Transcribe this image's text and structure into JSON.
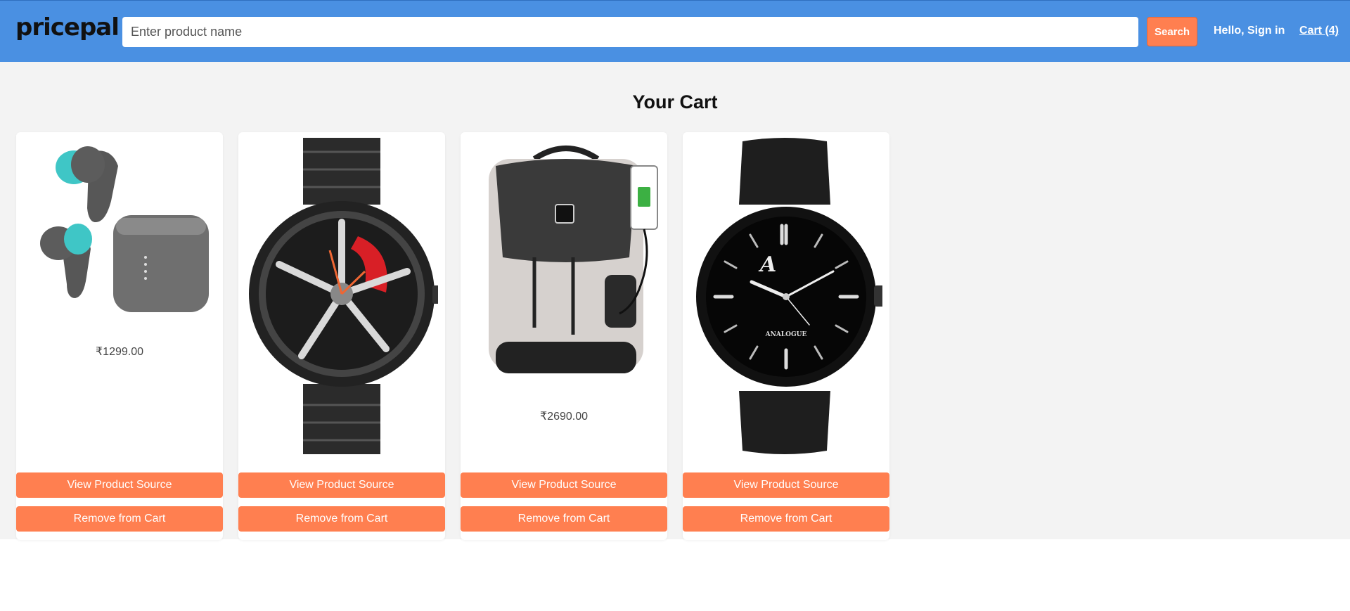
{
  "header": {
    "logo": "pricepal",
    "search_placeholder": "Enter product name",
    "search_label": "Search",
    "signin_label": "Hello, Sign in",
    "cart_label": "Cart (4)"
  },
  "main": {
    "title": "Your Cart",
    "items": [
      {
        "image": "wireless-earbuds",
        "price": "₹1299.00",
        "view_label": "View Product Source",
        "remove_label": "Remove from Cart"
      },
      {
        "image": "wheel-dial-watch",
        "price": "",
        "view_label": "View Product Source",
        "remove_label": "Remove from Cart"
      },
      {
        "image": "backpack-usb",
        "price": "₹2690.00",
        "view_label": "View Product Source",
        "remove_label": "Remove from Cart"
      },
      {
        "image": "black-analogue-watch",
        "price": "",
        "view_label": "View Product Source",
        "remove_label": "Remove from Cart",
        "watch_text": "ANALOGUE"
      }
    ]
  },
  "colors": {
    "header": "#4a90e2",
    "accent": "#ff7f50",
    "background": "#f3f3f3"
  }
}
